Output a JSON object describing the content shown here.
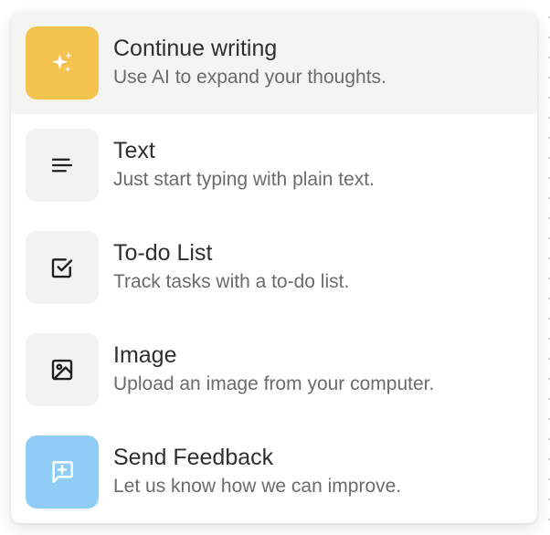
{
  "menu": {
    "items": [
      {
        "title": "Continue writing",
        "description": "Use AI to expand your thoughts.",
        "icon": "sparkles-icon",
        "icon_bg": "#f4c34f",
        "highlighted": true
      },
      {
        "title": "Text",
        "description": "Just start typing with plain text.",
        "icon": "text-lines-icon",
        "icon_bg": "#f2f2f2"
      },
      {
        "title": "To-do List",
        "description": "Track tasks with a to-do list.",
        "icon": "checkbox-icon",
        "icon_bg": "#f2f2f2"
      },
      {
        "title": "Image",
        "description": "Upload an image from your computer.",
        "icon": "image-icon",
        "icon_bg": "#f2f2f2"
      },
      {
        "title": "Send Feedback",
        "description": "Let us know how we can improve.",
        "icon": "message-plus-icon",
        "icon_bg": "#8fcdf7"
      }
    ]
  },
  "colors": {
    "highlight_bg": "#f4f4f3",
    "title_text": "#2f2f2f",
    "description_text": "#6b6b6b"
  }
}
